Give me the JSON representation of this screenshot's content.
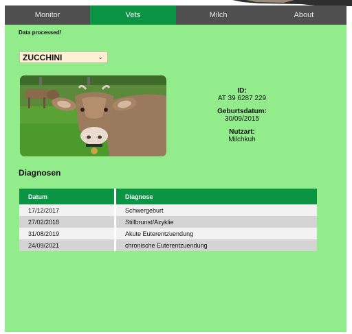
{
  "nav": {
    "items": [
      {
        "label": "Monitor",
        "active": false
      },
      {
        "label": "Vets",
        "active": true
      },
      {
        "label": "Milch",
        "active": false
      },
      {
        "label": "About",
        "active": false
      }
    ]
  },
  "status": "Data processed!",
  "animal_select": {
    "value": "ZUCCHINI"
  },
  "animal": {
    "id_label": "ID:",
    "id_value": "AT 39 6287 229",
    "birth_label": "Geburtsdatum:",
    "birth_value": "30/09/2015",
    "type_label": "Nutzart:",
    "type_value": "Milchkuh"
  },
  "diagnoses": {
    "title": "Diagnosen",
    "columns": [
      "Datum",
      "Diagnose"
    ],
    "rows": [
      {
        "date": "17/12/2017",
        "diagnosis": "Schwergeburt"
      },
      {
        "date": "27/02/2018",
        "diagnosis": "Stillbrunst/Azyklie"
      },
      {
        "date": "31/08/2019",
        "diagnosis": "Akute Euterentzuendung"
      },
      {
        "date": "24/09/2021",
        "diagnosis": "chronische Euterentzuendung"
      }
    ]
  },
  "colors": {
    "background": "#92ec8b",
    "accent": "#0b9444",
    "nav_bg": "#4f4f4f"
  }
}
